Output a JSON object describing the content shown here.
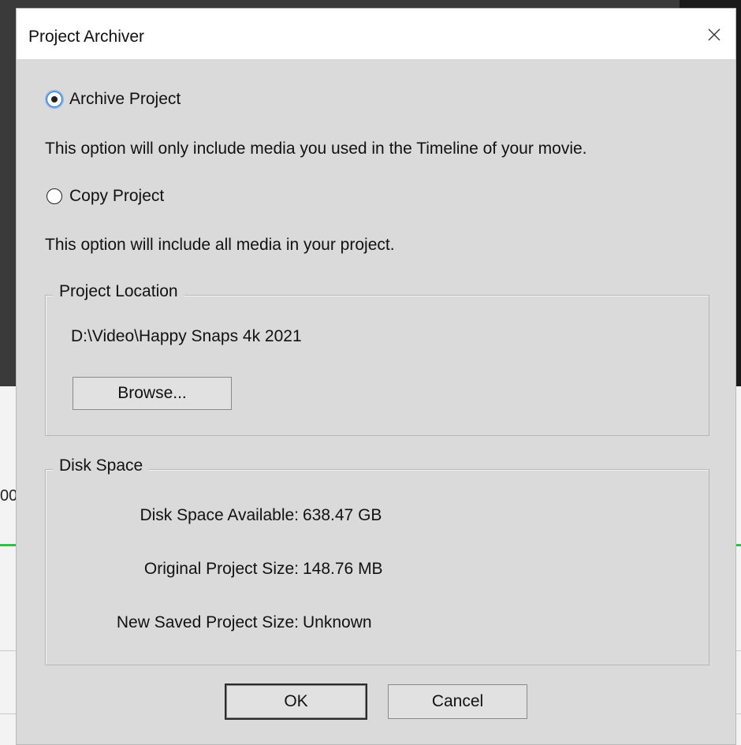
{
  "background": {
    "partial_text": "00"
  },
  "dialog": {
    "title": "Project Archiver",
    "close_icon": "close-icon"
  },
  "options": {
    "archive_label": "Archive Project",
    "archive_checked": true,
    "archive_description": "This option will only include media you used in the Timeline of your movie.",
    "copy_label": "Copy Project",
    "copy_checked": false,
    "copy_description": "This option will include all media in your project."
  },
  "project_location": {
    "legend": "Project Location",
    "path": "D:\\Video\\Happy Snaps 4k 2021",
    "browse_label": "Browse..."
  },
  "disk_space": {
    "legend": "Disk Space",
    "available_label": "Disk Space Available:",
    "available_value": "638.47 GB",
    "original_label": "Original Project Size:",
    "original_value": "148.76 MB",
    "new_label": "New Saved Project Size:",
    "new_value": "Unknown"
  },
  "buttons": {
    "ok_label": "OK",
    "cancel_label": "Cancel"
  },
  "colors": {
    "dialog_bg": "#dadada",
    "title_bg": "#ffffff",
    "radio_focus": "#2b6ec9",
    "bg_green_line": "#2fbf4a"
  }
}
